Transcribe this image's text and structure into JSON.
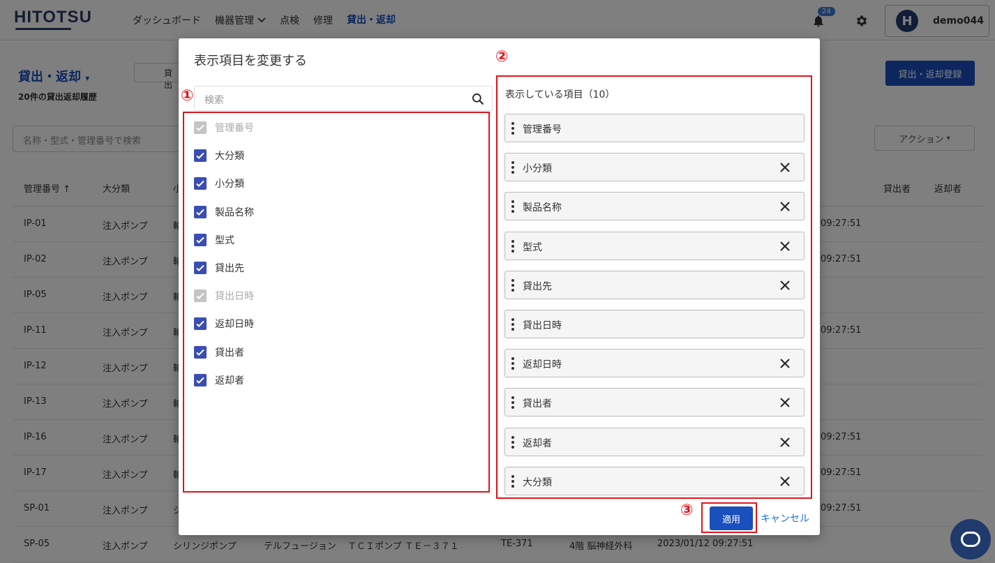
{
  "appbar": {
    "logo": "HITOTSU",
    "nav": [
      "ダッシュボード",
      "機器管理",
      "点検",
      "修理",
      "貸出・返却"
    ],
    "notification_count": "24",
    "user": {
      "avatar_letter": "H",
      "name": "demo044"
    }
  },
  "page": {
    "title": "貸出・返却",
    "subtitle": "20件の貸出返却履歴",
    "tab_fragment": "貸出",
    "register_button": "貸出・返却登録",
    "search_placeholder": "名称・型式・管理番号で検索",
    "action_button": "アクション",
    "table": {
      "headers": {
        "id": "管理番号 ↑",
        "category": "大分類",
        "sub_fragment": "小",
        "lender": "貸出者",
        "returner": "返却者"
      },
      "rows": [
        {
          "id": "IP-01",
          "category": "注入ポンプ",
          "sub": "輸",
          "product": "",
          "model": "",
          "model_no": "",
          "lend_to": "",
          "date": "",
          "time": "09:27:51"
        },
        {
          "id": "IP-02",
          "category": "注入ポンプ",
          "sub": "輸",
          "product": "",
          "model": "",
          "model_no": "",
          "lend_to": "",
          "date": "",
          "time": "09:27:51"
        },
        {
          "id": "IP-05",
          "category": "注入ポンプ",
          "sub": "輸",
          "product": "",
          "model": "",
          "model_no": "",
          "lend_to": "",
          "date": "",
          "time": ""
        },
        {
          "id": "IP-11",
          "category": "注入ポンプ",
          "sub": "輸",
          "product": "",
          "model": "",
          "model_no": "",
          "lend_to": "",
          "date": "",
          "time": "09:27:51"
        },
        {
          "id": "IP-12",
          "category": "注入ポンプ",
          "sub": "輸",
          "product": "",
          "model": "",
          "model_no": "",
          "lend_to": "",
          "date": "",
          "time": ""
        },
        {
          "id": "IP-13",
          "category": "注入ポンプ",
          "sub": "輸",
          "product": "",
          "model": "",
          "model_no": "",
          "lend_to": "",
          "date": "",
          "time": ""
        },
        {
          "id": "IP-16",
          "category": "注入ポンプ",
          "sub": "輸",
          "product": "",
          "model": "",
          "model_no": "",
          "lend_to": "",
          "date": "",
          "time": "09:27:51"
        },
        {
          "id": "IP-17",
          "category": "注入ポンプ",
          "sub": "輸",
          "product": "",
          "model": "",
          "model_no": "",
          "lend_to": "",
          "date": "",
          "time": "09:27:51"
        },
        {
          "id": "SP-01",
          "category": "注入ポンプ",
          "sub": "シ",
          "product": "",
          "model": "",
          "model_no": "",
          "lend_to": "",
          "date": "",
          "time": "09:27:51"
        },
        {
          "id": "SP-05",
          "category": "注入ポンプ",
          "sub": "シリンジポンプ",
          "product": "テルフュージョン",
          "model": "ＴＣＩポンプ ＴＥ－３７１",
          "model_no": "TE-371",
          "lend_to": "4階 脳神経外科",
          "date": "2023/01/12 09:27:51",
          "time": ""
        }
      ]
    }
  },
  "modal": {
    "title": "表示項目を変更する",
    "markers": [
      "①",
      "②",
      "③"
    ],
    "search_placeholder": "検索",
    "checkbox_items": [
      {
        "label": "管理番号",
        "checked": true,
        "disabled": true
      },
      {
        "label": "大分類",
        "checked": true,
        "disabled": false
      },
      {
        "label": "小分類",
        "checked": true,
        "disabled": false
      },
      {
        "label": "製品名称",
        "checked": true,
        "disabled": false
      },
      {
        "label": "型式",
        "checked": true,
        "disabled": false
      },
      {
        "label": "貸出先",
        "checked": true,
        "disabled": false
      },
      {
        "label": "貸出日時",
        "checked": true,
        "disabled": true
      },
      {
        "label": "返却日時",
        "checked": true,
        "disabled": false
      },
      {
        "label": "貸出者",
        "checked": true,
        "disabled": false
      },
      {
        "label": "返却者",
        "checked": true,
        "disabled": false
      }
    ],
    "shown_title": "表示している項目（10）",
    "shown_items": [
      {
        "label": "管理番号",
        "removable": false
      },
      {
        "label": "小分類",
        "removable": true
      },
      {
        "label": "製品名称",
        "removable": true
      },
      {
        "label": "型式",
        "removable": true
      },
      {
        "label": "貸出先",
        "removable": true
      },
      {
        "label": "貸出日時",
        "removable": false
      },
      {
        "label": "返却日時",
        "removable": true
      },
      {
        "label": "貸出者",
        "removable": true
      },
      {
        "label": "返却者",
        "removable": true
      },
      {
        "label": "大分類",
        "removable": true
      }
    ],
    "apply_label": "適用",
    "cancel_label": "キャンセル"
  },
  "colors": {
    "brand": "#2b3a67",
    "primary": "#1a4fbd",
    "annotation_red": "#e0141c",
    "checkbox": "#3a4db2"
  }
}
